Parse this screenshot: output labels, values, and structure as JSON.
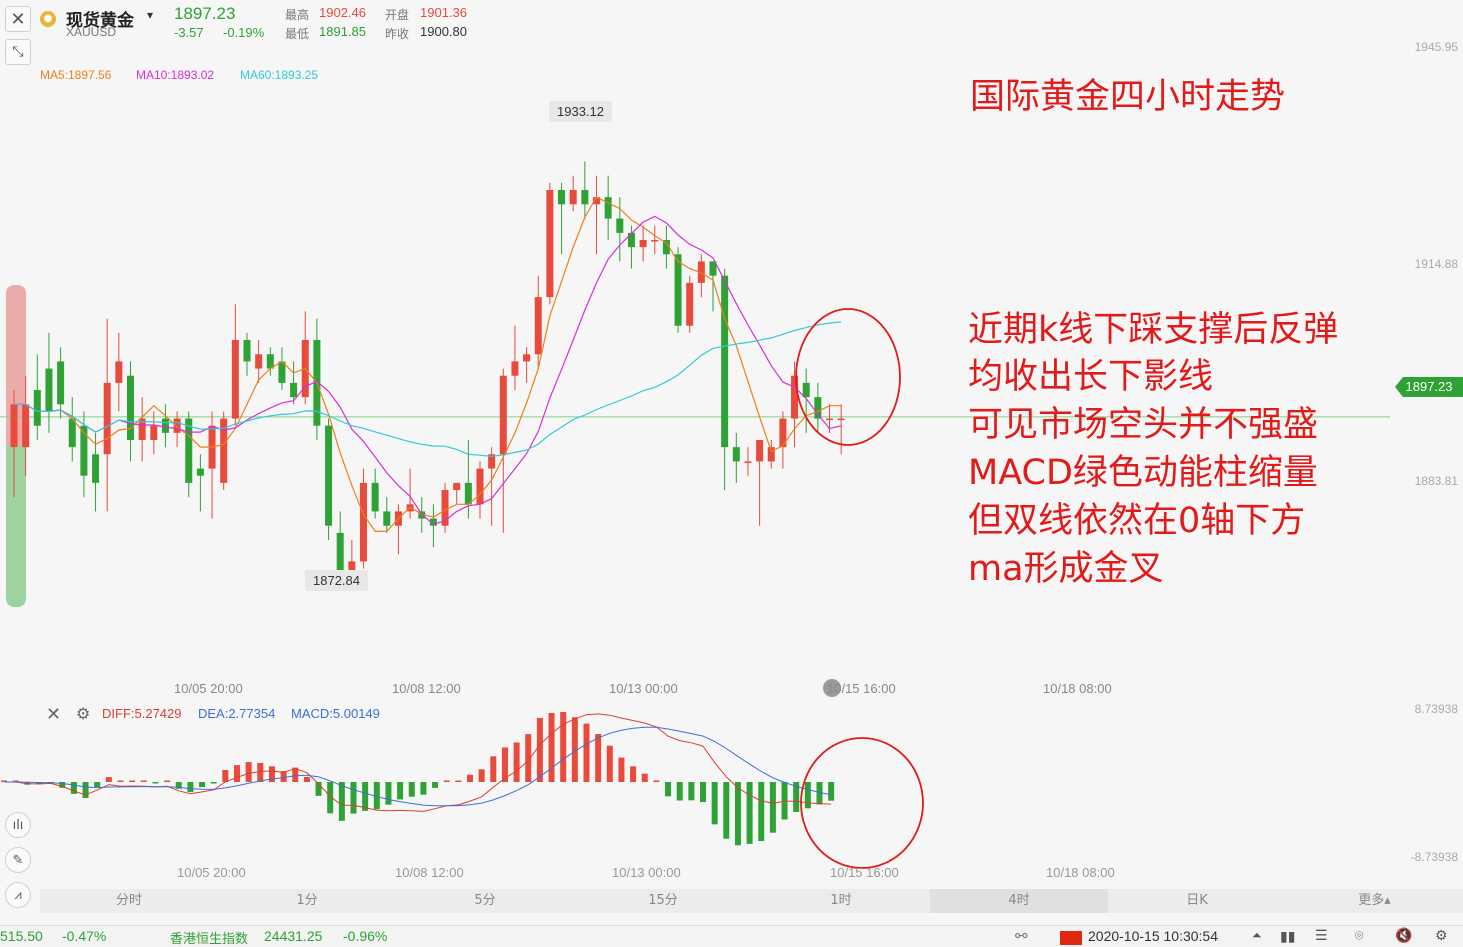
{
  "header": {
    "symbol_name": "现货黄金",
    "symbol_code": "XAUUSD",
    "price": "1897.23",
    "change": "-3.57",
    "change_pct": "-0.19%",
    "high_label": "最高",
    "high": "1902.46",
    "low_label": "最低",
    "low": "1891.85",
    "open_label": "开盘",
    "open": "1901.36",
    "prev_label": "昨收",
    "prev": "1900.80"
  },
  "ma_legend": {
    "ma5": "MA5:1897.56",
    "ma10": "MA10:1893.02",
    "ma60": "MA60:1893.25"
  },
  "colors": {
    "up": "#e84a3c",
    "down": "#2ea234",
    "ma5": "#f07e1b",
    "ma10": "#d52fd8",
    "ma60": "#35c9d6",
    "annotation": "#e21a1a",
    "dea": "#3b6fd8",
    "diff": "#d9402f"
  },
  "price_axis": [
    "1945.95",
    "1914.88",
    "1883.81"
  ],
  "current_price_tag": "1897.23",
  "high_marker": "1933.12",
  "low_marker": "1872.84",
  "time_labels": [
    "10/05 20:00",
    "10/08 12:00",
    "10/13 00:00",
    "10/15 16:00",
    "10/18 08:00"
  ],
  "macd_legend": {
    "diff": "DIFF:5.27429",
    "dea": "DEA:2.77354",
    "macd": "MACD:5.00149"
  },
  "macd_axis": [
    "8.73938",
    "-8.73938"
  ],
  "annotations": {
    "title": "国际黄金四小时走势",
    "lines": [
      "近期k线下踩支撑后反弹",
      "均收出长下影线",
      "可见市场空头并不强盛",
      "MACD绿色动能柱缩量",
      "但双线依然在0轴下方",
      "ma形成金叉"
    ]
  },
  "period_tabs": [
    "分时",
    "1分",
    "5分",
    "15分",
    "1时",
    "4时",
    "日K",
    "更多▴"
  ],
  "active_tab": "4时",
  "status": {
    "left_value": "515.50",
    "left_pct": "-0.47%",
    "index_name": "香港恒生指数",
    "index_value": "24431.25",
    "index_pct": "-0.96%",
    "datetime": "2020-10-15 10:30:54"
  },
  "chart_data": {
    "type": "candlestick",
    "ylim": [
      1866,
      1950
    ],
    "candles": [
      [
        1893,
        1899,
        1886,
        1901
      ],
      [
        1893,
        1899,
        1889,
        1903
      ],
      [
        1901,
        1896,
        1894,
        1906
      ],
      [
        1904,
        1898,
        1895,
        1909
      ],
      [
        1905,
        1899,
        1897,
        1907
      ],
      [
        1897,
        1893,
        1891,
        1900
      ],
      [
        1896,
        1889,
        1886,
        1898
      ],
      [
        1892,
        1888,
        1884,
        1895
      ],
      [
        1892,
        1902,
        1884,
        1911
      ],
      [
        1902,
        1905,
        1898,
        1909
      ],
      [
        1903,
        1894,
        1891,
        1905
      ],
      [
        1894,
        1897,
        1891,
        1900
      ],
      [
        1894,
        1896,
        1892,
        1898
      ],
      [
        1897,
        1895,
        1893,
        1899
      ],
      [
        1895,
        1897,
        1893,
        1898
      ],
      [
        1897,
        1888,
        1886,
        1898
      ],
      [
        1890,
        1889,
        1884,
        1892
      ],
      [
        1890,
        1896,
        1883,
        1898
      ],
      [
        1888,
        1897,
        1887,
        1898
      ],
      [
        1897,
        1908,
        1896,
        1913
      ],
      [
        1908,
        1905,
        1903,
        1909
      ],
      [
        1904,
        1906,
        1902,
        1908
      ],
      [
        1906,
        1904,
        1903,
        1907
      ],
      [
        1905,
        1902,
        1901,
        1907
      ],
      [
        1902,
        1900,
        1899,
        1905
      ],
      [
        1900,
        1908,
        1899,
        1912
      ],
      [
        1908,
        1896,
        1894,
        1911
      ],
      [
        1896,
        1882,
        1880,
        1897
      ],
      [
        1881,
        1875,
        1873,
        1884
      ],
      [
        1875,
        1877,
        1873,
        1880
      ],
      [
        1877,
        1888,
        1876,
        1890
      ],
      [
        1888,
        1884,
        1883,
        1890
      ],
      [
        1884,
        1882,
        1881,
        1886
      ],
      [
        1882,
        1884,
        1878,
        1885
      ],
      [
        1884,
        1885,
        1883,
        1890
      ],
      [
        1884,
        1883,
        1881,
        1886
      ],
      [
        1883,
        1882,
        1879,
        1885
      ],
      [
        1882,
        1887,
        1881,
        1888
      ],
      [
        1887,
        1888,
        1885,
        1888
      ],
      [
        1888,
        1885,
        1883,
        1894
      ],
      [
        1885,
        1890,
        1883,
        1891
      ],
      [
        1890,
        1892,
        1882,
        1893
      ],
      [
        1892,
        1903,
        1881,
        1904
      ],
      [
        1903,
        1905,
        1901,
        1910
      ],
      [
        1905,
        1906,
        1902,
        1907
      ],
      [
        1906,
        1914,
        1904,
        1917
      ],
      [
        1914,
        1929,
        1913,
        1930
      ],
      [
        1929,
        1927,
        1920,
        1930
      ],
      [
        1927,
        1929,
        1926,
        1931
      ],
      [
        1929,
        1927,
        1925,
        1933
      ],
      [
        1927,
        1928,
        1920,
        1931
      ],
      [
        1928,
        1925,
        1922,
        1931
      ],
      [
        1925,
        1923,
        1919,
        1928
      ],
      [
        1923,
        1921,
        1918,
        1924
      ],
      [
        1921,
        1922,
        1919,
        1924
      ],
      [
        1922,
        1922,
        1920,
        1924
      ],
      [
        1922,
        1920,
        1918,
        1924
      ],
      [
        1920,
        1910,
        1909,
        1921
      ],
      [
        1910,
        1916,
        1909,
        1917
      ],
      [
        1916,
        1919,
        1914,
        1920
      ],
      [
        1919,
        1917,
        1912,
        1919
      ],
      [
        1917,
        1893,
        1887,
        1918
      ],
      [
        1893,
        1891,
        1888,
        1895
      ],
      [
        1891,
        1891,
        1889,
        1893
      ],
      [
        1891,
        1894,
        1882,
        1894
      ],
      [
        1891,
        1893,
        1890,
        1894
      ],
      [
        1893,
        1897,
        1890,
        1898
      ],
      [
        1897,
        1903,
        1893,
        1905
      ],
      [
        1902,
        1900,
        1895,
        1904
      ],
      [
        1900,
        1897,
        1895,
        1902
      ],
      [
        1897,
        1897,
        1895,
        1899
      ],
      [
        1897,
        1897,
        1892,
        1899
      ]
    ]
  }
}
